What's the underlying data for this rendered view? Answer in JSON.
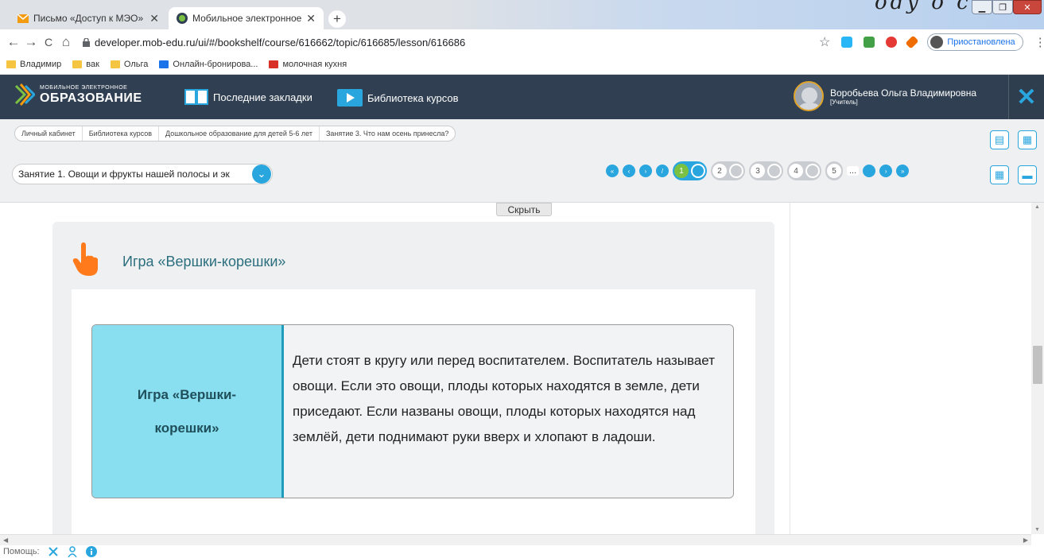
{
  "browser": {
    "tabs": [
      {
        "title": "Письмо «Доступ к МЭО» — Ро",
        "close": "✕"
      },
      {
        "title": "Мобильное электронное образ",
        "close": "✕"
      }
    ],
    "new_tab": "+",
    "handwritten": "ody o c",
    "window_controls": [
      "▁",
      "❐",
      "✕"
    ],
    "nav": {
      "back": "←",
      "forward": "→",
      "reload": "C",
      "home": "⌂"
    },
    "url": "developer.mob-edu.ru/ui/#/bookshelf/course/616662/topic/616685/lesson/616686",
    "star": "☆",
    "paused_label": "Приостановлена",
    "menu": "⋮",
    "bookmarks": [
      {
        "label": "Владимир",
        "color": "#f5c542"
      },
      {
        "label": "вак",
        "color": "#f5c542"
      },
      {
        "label": "Ольга",
        "color": "#f5c542"
      },
      {
        "label": "Онлайн-бронирова...",
        "color": "#1a73e8"
      },
      {
        "label": "молочная кухня",
        "color": "#d93025"
      }
    ]
  },
  "header": {
    "logo_small": "МОБИЛЬНОЕ ЭЛЕКТРОННОЕ",
    "logo_large": "ОБРАЗОВАНИЕ",
    "bookmarks_label": "Последние закладки",
    "library_label": "Библиотека курсов",
    "user_name": "Воробьева Ольга Владимировна",
    "user_role": "[Учитель]",
    "close": "✕"
  },
  "breadcrumbs": [
    "Личный кабинет",
    "Библиотека курсов",
    "Дошкольное образование для детей 5-6 лет",
    "Занятие 3. Что нам осень принесла?"
  ],
  "lesson_select": {
    "value": "Занятие 1. Овощи и фрукты нашей полосы и эк",
    "arrow": "⌄"
  },
  "pager": {
    "nav_left": [
      "«",
      "‹",
      "›",
      "/"
    ],
    "steps": [
      "1",
      "2",
      "3",
      "4",
      "5"
    ],
    "ellipsis": "...",
    "nav_right": [
      "●",
      "›",
      "»"
    ]
  },
  "content": {
    "hide_label": "Скрыть",
    "section_title": "Игра «Вершки-корешки»",
    "game_title": "Игра «Вершки-корешки»",
    "game_text": "Дети стоят в кругу или перед воспитателем. Воспитатель называет овощи. Если это овощи, плоды которых находятся в земле, дети приседают. Если названы овощи, плоды которых находятся над землёй, дети поднимают руки вверх и хлопают в ладоши."
  },
  "footer": {
    "help_label": "Помощь:"
  },
  "colors": {
    "header_bg": "#304052",
    "accent": "#2aa6df",
    "game_label_bg": "#89def0",
    "hand": "#ff7a1a"
  }
}
